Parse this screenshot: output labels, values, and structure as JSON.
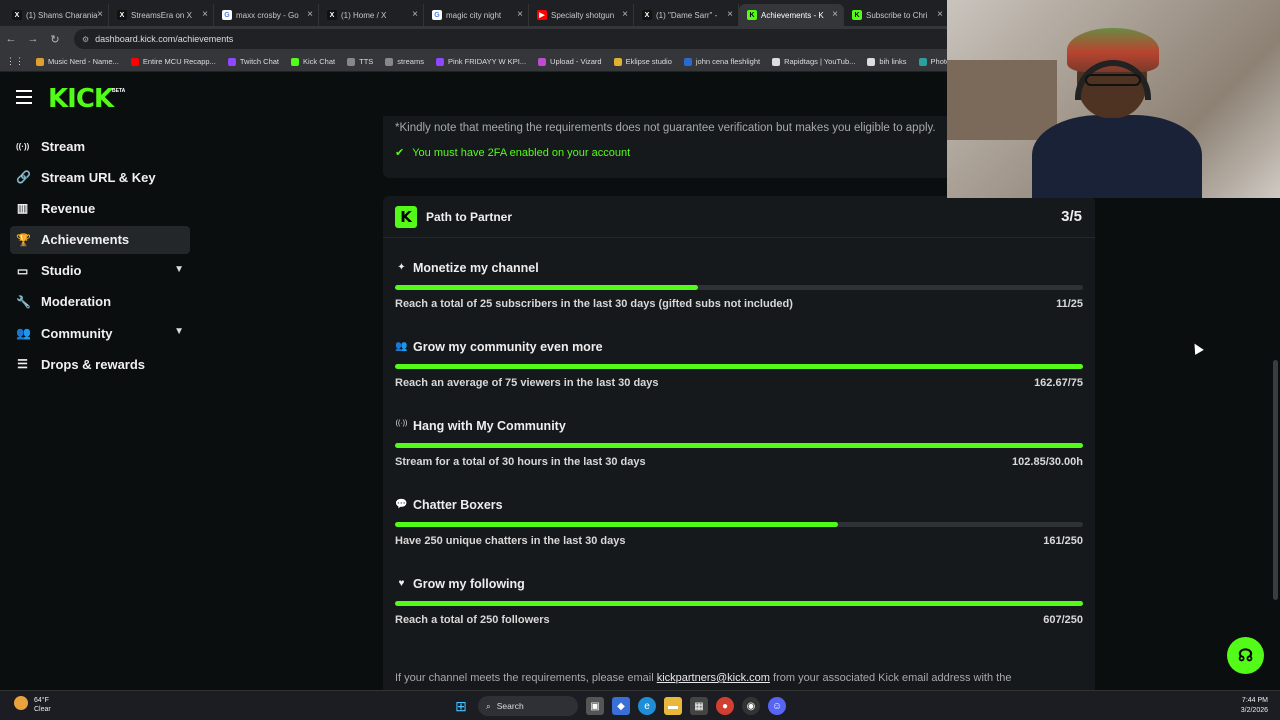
{
  "browser": {
    "tabs": [
      {
        "label": "(1) Shams Charania",
        "icon": "x-icon",
        "color": "#111111"
      },
      {
        "label": "StreamsEra on X",
        "icon": "x-icon",
        "color": "#111111"
      },
      {
        "label": "maxx crosby - Go",
        "icon": "google-icon",
        "color": "#ffffff"
      },
      {
        "label": "(1) Home / X",
        "icon": "x-icon",
        "color": "#111111"
      },
      {
        "label": "magic city night",
        "icon": "google-icon",
        "color": "#ffffff"
      },
      {
        "label": "Specialty shotgun",
        "icon": "youtube-icon",
        "color": "#ff0000"
      },
      {
        "label": "(1) \"Dame Sarr\" -",
        "icon": "x-icon",
        "color": "#111111"
      },
      {
        "label": "Achievements - K",
        "icon": "kick-icon",
        "color": "#53fc18",
        "active": true
      },
      {
        "label": "Subscribe to Chri",
        "icon": "kick-icon",
        "color": "#53fc18"
      }
    ],
    "url": "dashboard.kick.com/achievements",
    "bookmarks": [
      {
        "label": "Music Nerd - Name...",
        "color": "#e0a030"
      },
      {
        "label": "Entire MCU Recapp...",
        "color": "#ff0000"
      },
      {
        "label": "Twitch Chat",
        "color": "#9146ff"
      },
      {
        "label": "Kick Chat",
        "color": "#53fc18"
      },
      {
        "label": "TTS",
        "color": "#888888"
      },
      {
        "label": "streams",
        "color": "#888888"
      },
      {
        "label": "Pink FRIDAYY W KPI...",
        "color": "#9146ff"
      },
      {
        "label": "Upload - Vizard",
        "color": "#c04ad0"
      },
      {
        "label": "Eklipse studio",
        "color": "#e0b030"
      },
      {
        "label": "john cena fleshlight",
        "color": "#2a6ad0"
      },
      {
        "label": "Rapidtags | YouTub...",
        "color": "#dddddd"
      },
      {
        "label": "bih links",
        "color": "#dddddd"
      },
      {
        "label": "Photop",
        "color": "#2aa0a0"
      }
    ]
  },
  "app": {
    "logo": "KICK",
    "beta": "BETA",
    "accent": "#53fc18"
  },
  "sidebar": {
    "items": [
      {
        "label": "Stream",
        "icon": "broadcast-icon",
        "glyph": "((·))"
      },
      {
        "label": "Stream URL & Key",
        "icon": "link-icon",
        "glyph": "🔗"
      },
      {
        "label": "Revenue",
        "icon": "chart-icon",
        "glyph": "▥"
      },
      {
        "label": "Achievements",
        "icon": "trophy-icon",
        "glyph": "🏆",
        "active": true
      },
      {
        "label": "Studio",
        "icon": "monitor-icon",
        "glyph": "▭",
        "expandable": true
      },
      {
        "label": "Moderation",
        "icon": "wrench-icon",
        "glyph": "🔧"
      },
      {
        "label": "Community",
        "icon": "users-icon",
        "glyph": "👥",
        "expandable": true
      },
      {
        "label": "Drops & rewards",
        "icon": "gift-icon",
        "glyph": "☰"
      }
    ]
  },
  "verification": {
    "note": "*Kindly note that meeting the requirements does not guarantee verification but makes you eligible to apply.",
    "requirement": "You must have 2FA enabled on your account"
  },
  "partner": {
    "title": "Path to Partner",
    "score": "3/5",
    "achievements": [
      {
        "title": "Monetize my channel",
        "icon": "sparkle-icon",
        "glyph": "✦",
        "description": "Reach a total of 25 subscribers in the last 30 days (gifted subs not included)",
        "progress_text": "11/25",
        "progress": 0.44
      },
      {
        "title": "Grow my community even more",
        "icon": "users-icon",
        "glyph": "👥",
        "description": "Reach an average of 75 viewers in the last 30 days",
        "progress_text": "162.67/75",
        "progress": 1.0
      },
      {
        "title": "Hang with My Community",
        "icon": "broadcast-icon",
        "glyph": "((·))",
        "description": "Stream for a total of 30 hours in the last 30 days",
        "progress_text": "102.85/30.00h",
        "progress": 1.0
      },
      {
        "title": "Chatter Boxers",
        "icon": "chat-icon",
        "glyph": "💬",
        "description": "Have 250 unique chatters in the last 30 days",
        "progress_text": "161/250",
        "progress": 0.644
      },
      {
        "title": "Grow my following",
        "icon": "heart-icon",
        "glyph": "♥",
        "description": "Reach a total of 250 followers",
        "progress_text": "607/250",
        "progress": 1.0
      }
    ],
    "footer_prefix": "If your channel meets the requirements, please email ",
    "footer_email": "kickpartners@kick.com",
    "footer_suffix": " from your associated Kick email address with the"
  },
  "taskbar": {
    "weather_temp": "64°F",
    "weather_desc": "Clear",
    "search_label": "Search",
    "time": "7:44 PM",
    "date": "3/2/2026"
  }
}
